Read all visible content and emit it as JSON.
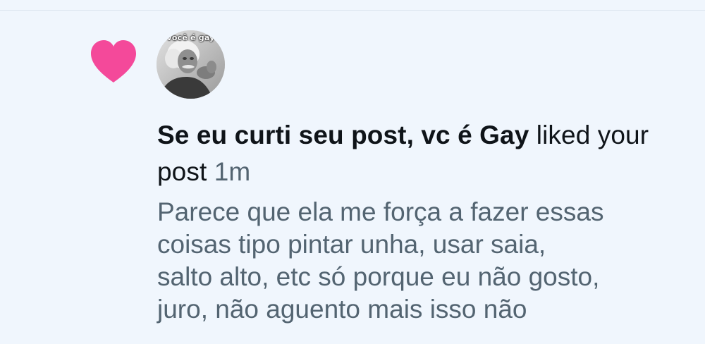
{
  "notification": {
    "type_icon": "heart-icon",
    "type_icon_color": "#f4499a",
    "avatar": {
      "caption": "você é gay"
    },
    "username": "Se eu curti seu post, vc é Gay",
    "action": "liked your post",
    "timestamp": "1m",
    "post_preview": "Parece que ela me força a fazer essas\ncoisas tipo pintar unha, usar saia,\nsalto alto, etc só porque eu não gosto,\njuro, não aguento mais isso não"
  }
}
